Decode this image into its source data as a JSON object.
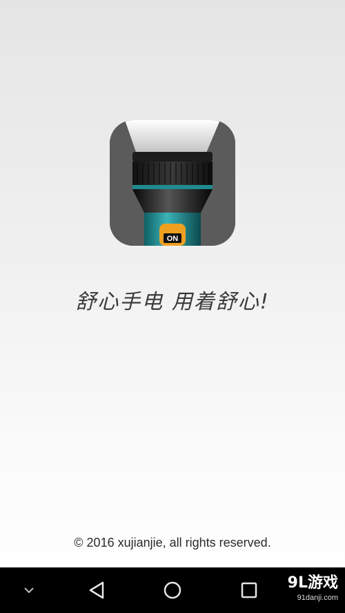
{
  "app": {
    "icon_name": "flashlight-icon",
    "icon_badge": "ON",
    "slogan": "舒心手电 用着舒心!",
    "copyright": "© 2016 xujianjie, all rights reserved."
  },
  "navbar": {
    "items": [
      {
        "icon": "chevron-down-icon"
      },
      {
        "icon": "back-triangle-icon"
      },
      {
        "icon": "home-circle-icon"
      },
      {
        "icon": "recents-square-icon"
      }
    ]
  },
  "watermark": {
    "main": "9L游戏",
    "sub": "91danji.com"
  },
  "colors": {
    "background_top": "#e5e5e5",
    "background_bottom": "#ffffff",
    "navbar": "#000000",
    "flashlight_teal": "#2a9aa0",
    "badge_orange": "#f0a020"
  }
}
